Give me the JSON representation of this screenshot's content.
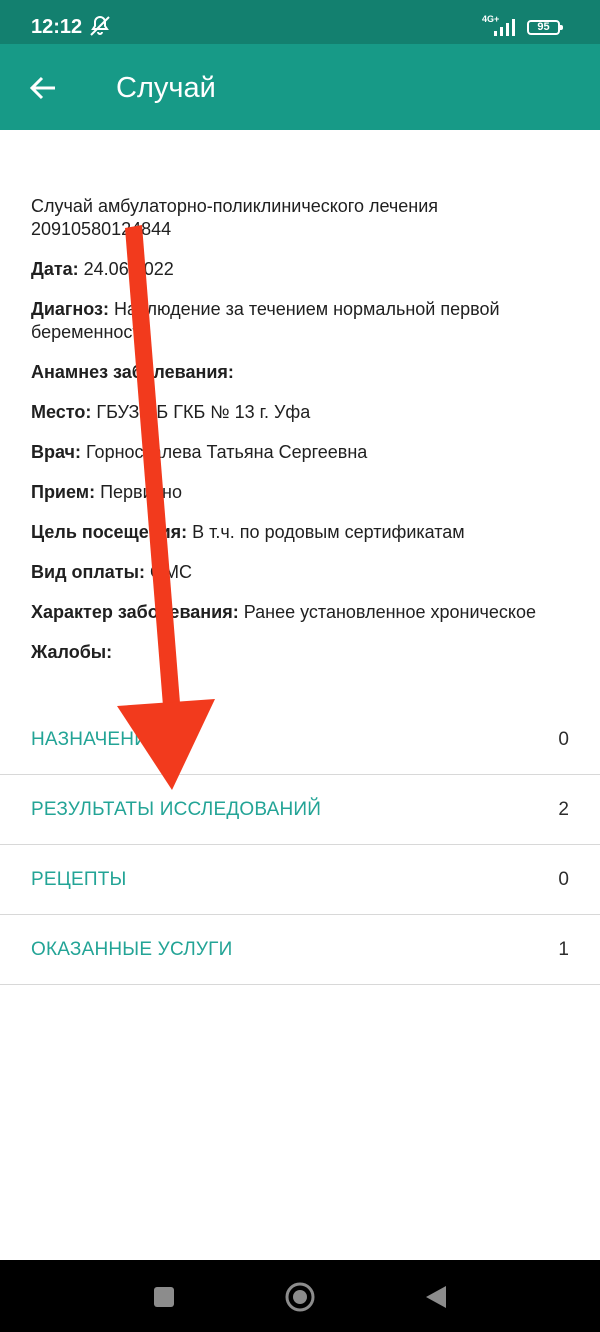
{
  "status_bar": {
    "time": "12:12",
    "network": "4G+",
    "battery": "95",
    "icons": [
      "mute-icon",
      "signal-icon",
      "battery-icon"
    ]
  },
  "app_bar": {
    "title": "Случай",
    "back_icon": "arrow-left-icon",
    "background": "#179a87"
  },
  "case": {
    "title": "Случай амбулаторно-поликлинического лечения 20910580124844",
    "fields": [
      {
        "label": "Дата:",
        "value": " 24.06.2022"
      },
      {
        "label": "Диагноз:",
        "value": " Наблюдение за течением нормальной первой беременности"
      },
      {
        "label": "Анамнез заболевания:",
        "value": ""
      },
      {
        "label": "Место:",
        "value": " ГБУЗ РБ ГКБ № 13 г. Уфа"
      },
      {
        "label": "Врач:",
        "value": " Горносталева Татьяна Сергеевна"
      },
      {
        "label": "Прием:",
        "value": " Первично"
      },
      {
        "label": "Цель посещения:",
        "value": " В т.ч. по родовым сертификатам"
      },
      {
        "label": "Вид оплаты:",
        "value": " ОМС"
      },
      {
        "label": "Характер заболевания:",
        "value": " Ранее установленное хроническое"
      },
      {
        "label": "Жалобы:",
        "value": ""
      }
    ]
  },
  "sections": [
    {
      "label": "НАЗНАЧЕНИЯ",
      "count": "0"
    },
    {
      "label": "РЕЗУЛЬТАТЫ ИССЛЕДОВАНИЙ",
      "count": "2"
    },
    {
      "label": "РЕЦЕПТЫ",
      "count": "0"
    },
    {
      "label": "ОКАЗАННЫЕ УСЛУГИ",
      "count": "1"
    }
  ],
  "colors": {
    "accent": "#23a496",
    "status_bar": "#13806f",
    "annotation_arrow": "#f23a1d"
  },
  "nav_bar": {
    "icons": [
      "recent-apps-icon",
      "home-icon",
      "back-icon"
    ]
  }
}
